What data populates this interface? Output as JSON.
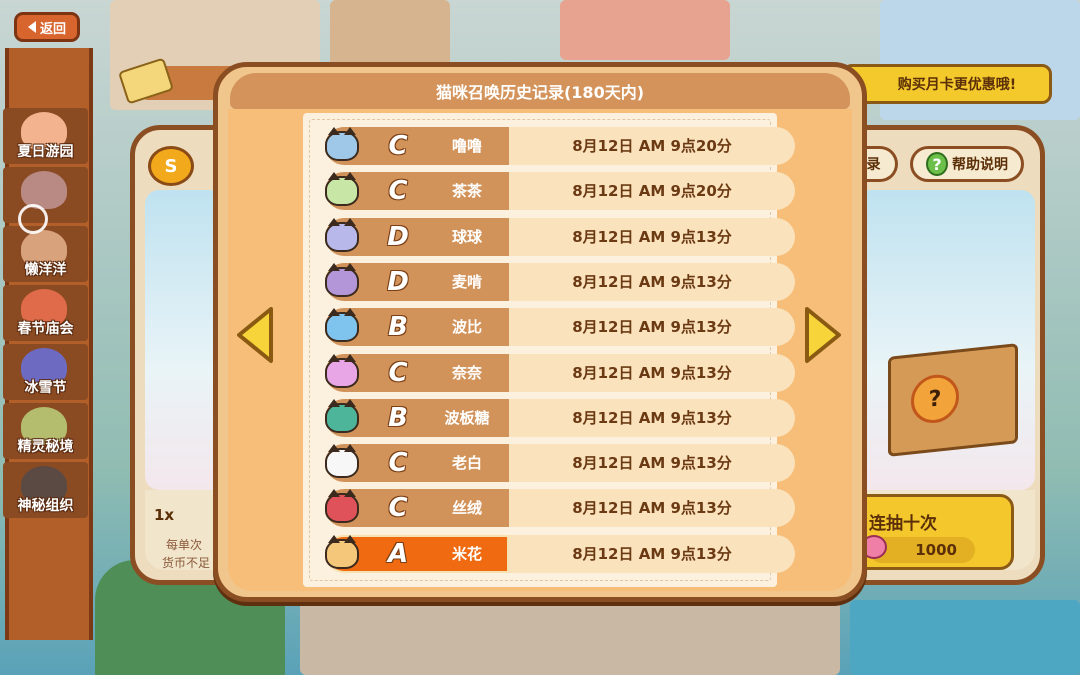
{
  "nav": {
    "back_label": "返回"
  },
  "sidebar": {
    "items": [
      {
        "label": "夏日游园",
        "color": "#f3b38e"
      },
      {
        "label": "",
        "color": "#b88a83"
      },
      {
        "label": "懒洋洋",
        "color": "#d7a27c"
      },
      {
        "label": "春节庙会",
        "color": "#e06b4a"
      },
      {
        "label": "冰雪节",
        "color": "#6d6ac2"
      },
      {
        "label": "精灵秘境",
        "color": "#b4bd6e"
      },
      {
        "label": "神秘组织",
        "color": "#5b4a44"
      }
    ]
  },
  "shop": {
    "currency_symbol": "S",
    "promo": "购买月卡更优惠哦!",
    "record_label": "录",
    "help_label": "帮助说明",
    "help_glyph": "?",
    "box_glyph": "?",
    "ten_draw_label": "连抽十次",
    "ten_draw_cost": "1000",
    "single_draw_qty": "1x",
    "single_note_1": "每单次",
    "single_note_2": "货币不足"
  },
  "history": {
    "title": "猫咪召唤历史记录(180天内)",
    "rows": [
      {
        "grade": "C",
        "name": "噜噜",
        "time": "8月12日 AM 9点20分",
        "avatar_color": "#9fc8e8",
        "selected": false
      },
      {
        "grade": "C",
        "name": "茶茶",
        "time": "8月12日 AM 9点20分",
        "avatar_color": "#c8e6a6",
        "selected": false
      },
      {
        "grade": "D",
        "name": "球球",
        "time": "8月12日 AM 9点13分",
        "avatar_color": "#b8b8ea",
        "selected": false
      },
      {
        "grade": "D",
        "name": "麦啃",
        "time": "8月12日 AM 9点13分",
        "avatar_color": "#b296d8",
        "selected": false
      },
      {
        "grade": "B",
        "name": "波比",
        "time": "8月12日 AM 9点13分",
        "avatar_color": "#7fc4ee",
        "selected": false
      },
      {
        "grade": "C",
        "name": "奈奈",
        "time": "8月12日 AM 9点13分",
        "avatar_color": "#e8a6e6",
        "selected": false
      },
      {
        "grade": "B",
        "name": "波板糖",
        "time": "8月12日 AM 9点13分",
        "avatar_color": "#4cb59a",
        "selected": false
      },
      {
        "grade": "C",
        "name": "老白",
        "time": "8月12日 AM 9点13分",
        "avatar_color": "#f7f7f7",
        "selected": false
      },
      {
        "grade": "C",
        "name": "丝绒",
        "time": "8月12日 AM 9点13分",
        "avatar_color": "#e0525a",
        "selected": false
      },
      {
        "grade": "A",
        "name": "米花",
        "time": "8月12日 AM 9点13分",
        "avatar_color": "#f4c77a",
        "selected": true
      }
    ]
  },
  "colors": {
    "frame_brown": "#8b4d22",
    "modal_fill": "#f0c68d",
    "row_left": "#d2935a",
    "row_selected": "#ef6a10",
    "arrow_yellow": "#f6d43a"
  }
}
